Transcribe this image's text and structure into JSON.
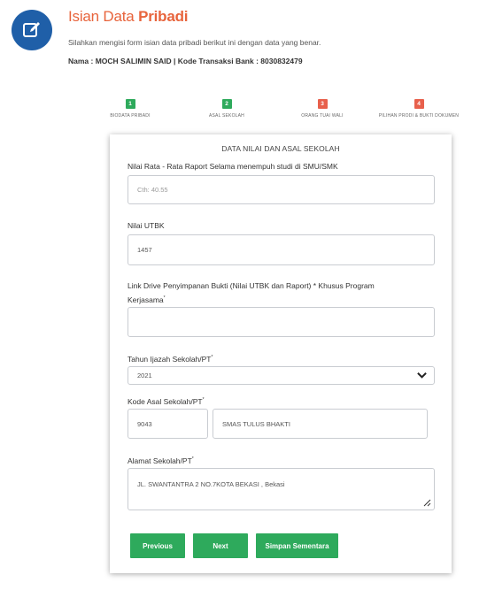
{
  "header": {
    "icon": "edit-icon",
    "title_plain": "Isian Data ",
    "title_bold": "Pribadi",
    "subtitle": "Silahkan mengisi form isian data pribadi berikut ini dengan data yang benar.",
    "info": "Nama : MOCH SALIMIN SAID | Kode Transaksi Bank : 8030832479"
  },
  "colors": {
    "accent_orange": "#e8643c",
    "icon_blue": "#1f5fa8",
    "green": "#2eaa5c",
    "red_step": "#e8604c"
  },
  "steps": [
    {
      "number": "1",
      "label": "BIODATA PRIBADI",
      "status": "done"
    },
    {
      "number": "2",
      "label": "ASAL SEKOLAH",
      "status": "done"
    },
    {
      "number": "3",
      "label": "ORANG TUA/ WALI",
      "status": "todo"
    },
    {
      "number": "4",
      "label": "PILIHAN PRODI & BUKTI DOKUMEN",
      "status": "todo"
    }
  ],
  "form": {
    "title": "DATA NILAI DAN ASAL SEKOLAH",
    "raport": {
      "label": "Nilai Rata - Rata Raport Selama menempuh studi di SMU/SMK",
      "placeholder": "Cth: 40.55",
      "value": ""
    },
    "utbk": {
      "label": "Nilai UTBK",
      "value": "1457"
    },
    "link": {
      "label_line1": "Link Drive Penyimpanan Bukti (Nilai UTBK dan Raport) * Khusus Program",
      "label_line2": "Kerjasama",
      "required": "*",
      "value": ""
    },
    "tahun": {
      "label": "Tahun Ijazah Sekolah/PT",
      "required": "*",
      "value": "2021"
    },
    "kode": {
      "label": "Kode Asal Sekolah/PT",
      "required": "*",
      "code": "9043",
      "name": "SMAS TULUS BHAKTI"
    },
    "alamat": {
      "label": "Alamat Sekolah/PT",
      "required": "*",
      "value": "JL. SWANTANTRA 2 NO.7KOTA BEKASI , Bekasi"
    }
  },
  "buttons": {
    "previous": "Previous",
    "next": "Next",
    "save_draft": "Simpan Sementara"
  }
}
